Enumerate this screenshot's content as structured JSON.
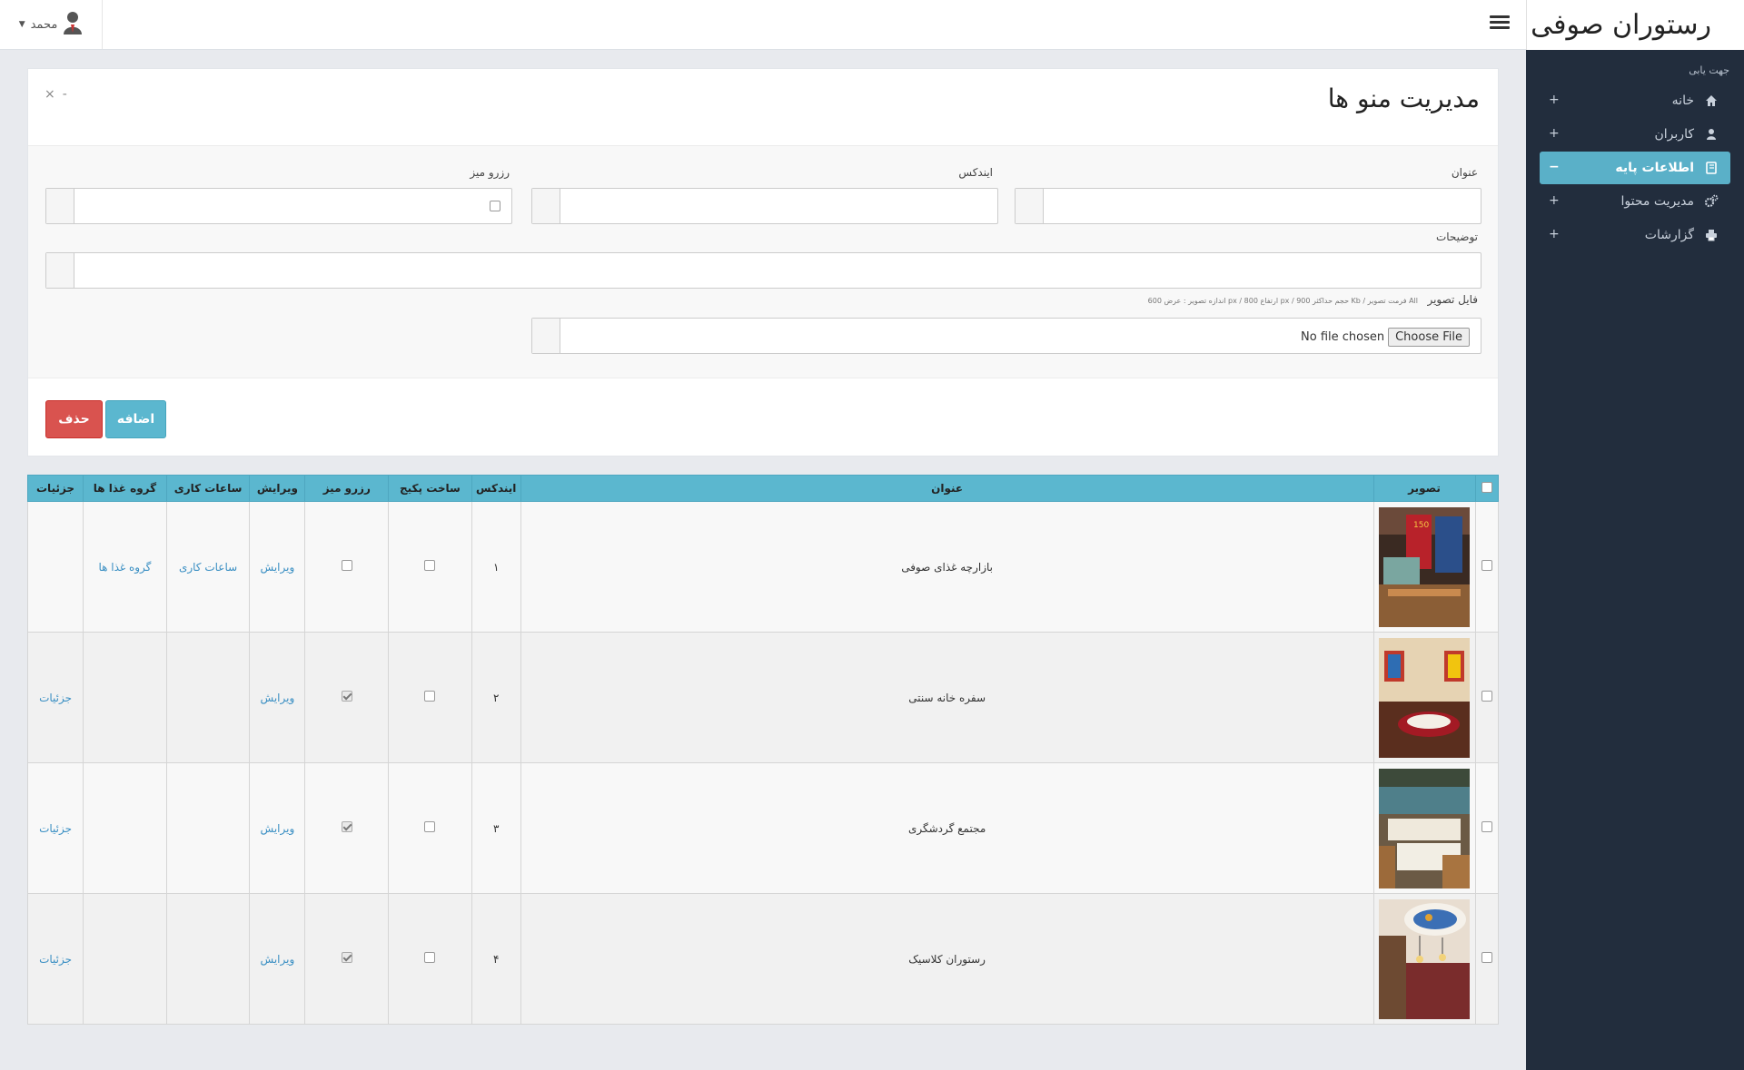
{
  "brand": "رستوران صوفی",
  "topbar": {
    "user_name": "محمد"
  },
  "sidebar": {
    "caption": "جهت یابی",
    "items": [
      {
        "label": "خانه",
        "icon": "home-icon",
        "sign": "+"
      },
      {
        "label": "کاربران",
        "icon": "user-icon",
        "sign": "+"
      },
      {
        "label": "اطلاعات پایه",
        "icon": "book-icon",
        "sign": "−",
        "active": true
      },
      {
        "label": "مدیریت محتوا",
        "icon": "gears-icon",
        "sign": "+"
      },
      {
        "label": "گزارشات",
        "icon": "print-icon",
        "sign": "+"
      }
    ]
  },
  "panel": {
    "title": "مدیریت منو ها",
    "tools": {
      "close": "×",
      "collapse": "-"
    },
    "form": {
      "title_label": "عنوان",
      "index_label": "ایندکس",
      "reserve_label": "رزرو میز",
      "desc_label": "توضیحات",
      "image_label": "فایل تصویر",
      "image_hint": "اندازه تصویر : عرض 600 px / ارتفاع 800 px / حجم حداکثر 900 Kb / فرمت تصویر All",
      "choose_file": "Choose File",
      "no_file": "No file chosen"
    },
    "buttons": {
      "add": "اضافه",
      "delete": "حذف"
    }
  },
  "table": {
    "headers": {
      "image": "تصویر",
      "title": "عنوان",
      "index": "ایندکس",
      "package": "ساخت پکیج",
      "reserve": "رزرو میز",
      "edit": "ویرایش",
      "hours": "ساعات کاری",
      "groups": "گروه غذا ها",
      "details": "جزئیات"
    },
    "rows": [
      {
        "title": "بازارچه غذای صوفی",
        "index": "۱",
        "package": false,
        "reserve": false,
        "edit": "ویرایش",
        "hours": "ساعات کاری",
        "groups": "گروه غذا ها",
        "details": ""
      },
      {
        "title": "سفره خانه سنتی",
        "index": "۲",
        "package": false,
        "reserve": true,
        "edit": "ویرایش",
        "hours": "",
        "groups": "",
        "details": "جزئیات"
      },
      {
        "title": "مجتمع گردشگری",
        "index": "۳",
        "package": false,
        "reserve": true,
        "edit": "ویرایش",
        "hours": "",
        "groups": "",
        "details": "جزئیات"
      },
      {
        "title": "رستوران کلاسیک",
        "index": "۴",
        "package": false,
        "reserve": true,
        "edit": "ویرایش",
        "hours": "",
        "groups": "",
        "details": "جزئیات"
      }
    ]
  }
}
